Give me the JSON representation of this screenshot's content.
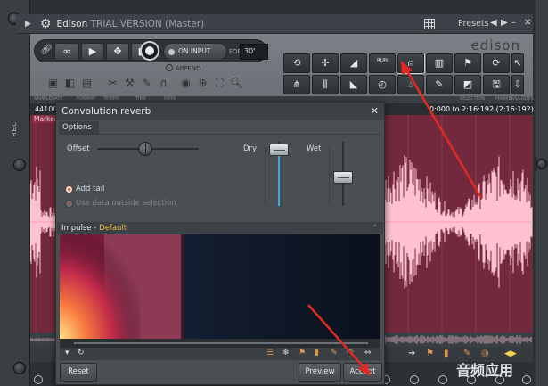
{
  "window": {
    "title": "Edison",
    "title_sub": "TRIAL VERSION (Master)",
    "presets_label": "Presets",
    "side_label": "REC"
  },
  "panel": {
    "logo": "edison",
    "on_input_label": "ON INPUT",
    "for_label": "FOR",
    "seconds_value": "30'",
    "append_label": "APPEND",
    "run_label": "RUN"
  },
  "ruler": {
    "labels": [
      "SAMPLERATE",
      "FORMAT",
      "TEMPO",
      "TIME",
      "DATA"
    ],
    "selection_label": "SELECTION",
    "markers_label": "MARKERS/LOOPS",
    "samplerate": "44100",
    "selection_readout": "0:000 to 2:16:192 (2:16:192)",
    "marker_label": "Marker"
  },
  "dialog": {
    "title": "Convolution reverb",
    "options_tab": "Options",
    "offset_label": "Offset",
    "dry_label": "Dry",
    "wet_label": "Wet",
    "add_tail_label": "Add tail",
    "use_data_label": "Use data outside selection",
    "impulse_label": "Impulse",
    "impulse_sep": " - ",
    "impulse_name": "Default",
    "reset_label": "Reset",
    "preview_label": "Preview",
    "accept_label": "Accept",
    "dry_level": 0.96,
    "wet_level": 0.43
  },
  "watermark": "音频应用",
  "colors": {
    "wave_bg": "#73293d",
    "wave_fg": "#ffc2d2",
    "accent_blue": "#3fa6d8",
    "arrow_red": "#e02a1f",
    "impulse_name": "#f2b84a"
  }
}
